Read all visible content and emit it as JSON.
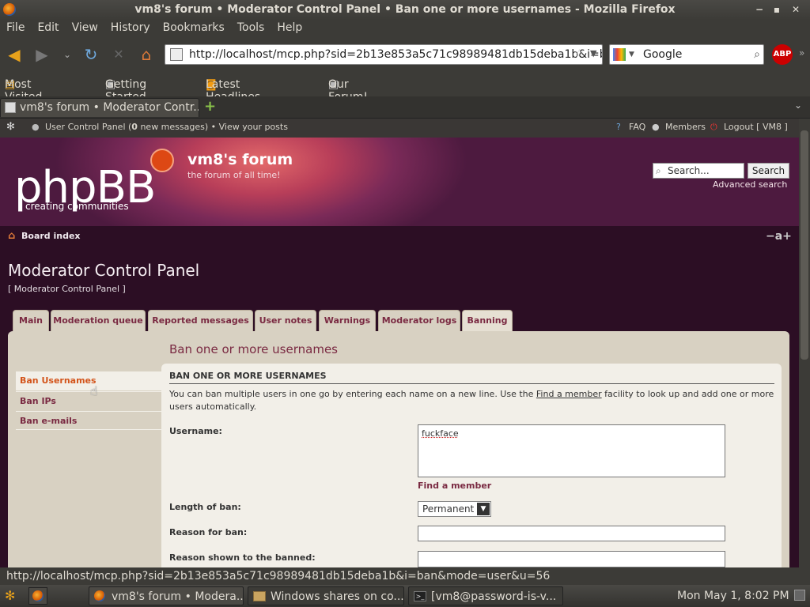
{
  "window": {
    "title": "vm8's forum • Moderator Control Panel • Ban one or more usernames - Mozilla Firefox"
  },
  "menu": [
    "File",
    "Edit",
    "View",
    "History",
    "Bookmarks",
    "Tools",
    "Help"
  ],
  "navbar": {
    "url": "http://localhost/mcp.php?sid=2b13e853a5c71c98989481db15deba1b&i=b",
    "search_engine": "Google"
  },
  "bookmarks": [
    "Most Visited",
    "Getting Started",
    "Latest Headlines",
    "Our Forum!"
  ],
  "tab": {
    "label": "vm8's forum • Moderator Contr..."
  },
  "forum": {
    "topbar": {
      "ucp_prefix": "User Control Panel (",
      "new_count": "0",
      "ucp_suffix": " new messages) • View your posts",
      "faq": "FAQ",
      "members": "Members",
      "logout": "Logout [ VM8 ]"
    },
    "logo": "phpBB",
    "logo_sub": "creating  communities",
    "site_name": "vm8's forum",
    "site_desc": "the forum of all time!",
    "search_placeholder": "Search...",
    "search_button": "Search",
    "advanced_search": "Advanced search",
    "breadcrumb": "Board index",
    "font_resize": "−a+",
    "mcp_title": "Moderator Control Panel",
    "mcp_sub": "[ Moderator Control Panel ]",
    "tabs": [
      "Main",
      "Moderation queue",
      "Reported messages",
      "User notes",
      "Warnings",
      "Moderator logs",
      "Banning"
    ],
    "panel_title": "Ban one or more usernames",
    "side_menu": [
      "Ban Usernames",
      "Ban IPs",
      "Ban e-mails"
    ],
    "form_heading": "BAN ONE OR MORE USERNAMES",
    "form_desc_1": "You can ban multiple users in one go by entering each name on a new line. Use the ",
    "form_desc_link": "Find a member",
    "form_desc_2": " facility to look up and add one or more users automatically.",
    "username_label": "Username:",
    "username_value": "fuckface",
    "find_member": "Find a member",
    "length_label": "Length of ban:",
    "length_value": "Permanent",
    "reason_label": "Reason for ban:",
    "reason_shown_label": "Reason shown to the banned:"
  },
  "status": "http://localhost/mcp.php?sid=2b13e853a5c71c98989481db15deba1b&i=ban&mode=user&u=56",
  "taskbar": {
    "tasks": [
      "vm8's forum • Modera...",
      "Windows shares on co...",
      "[vm8@password-is-v..."
    ],
    "clock": "Mon May  1,  8:02 PM"
  }
}
